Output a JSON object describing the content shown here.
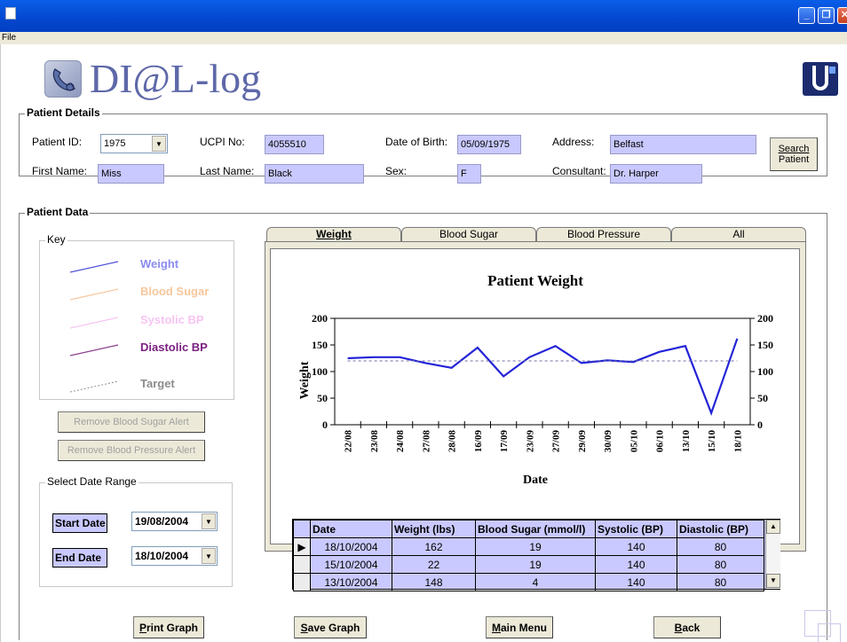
{
  "app": {
    "title": "DI@L-log",
    "menu_file": "File"
  },
  "patient_details": {
    "group_title": "Patient Details",
    "patient_id_label": "Patient ID:",
    "patient_id": "1975",
    "ucpi_label": "UCPI No:",
    "ucpi": "4055510",
    "dob_label": "Date of Birth:",
    "dob": "05/09/1975",
    "address_label": "Address:",
    "address": "Belfast",
    "first_name_label": "First Name:",
    "first_name": "Miss",
    "last_name_label": "Last Name:",
    "last_name": "Black",
    "sex_label": "Sex:",
    "sex": "F",
    "consultant_label": "Consultant:",
    "consultant": "Dr. Harper",
    "search_button": [
      "Search",
      "Patient"
    ]
  },
  "patient_data": {
    "group_title": "Patient Data",
    "key": {
      "title": "Key",
      "items": [
        {
          "label": "Weight",
          "color": "#8b8bf0",
          "line": "#5050d8"
        },
        {
          "label": "Blood Sugar",
          "color": "#f6c79c",
          "line": "#f6c79c"
        },
        {
          "label": "Systolic BP",
          "color": "#f7c4f2",
          "line": "#f7c4f2"
        },
        {
          "label": "Diastolic BP",
          "color": "#7a2080",
          "line": "#8a3c90"
        },
        {
          "label": "Target",
          "color": "#8c8c8c",
          "line": "#8c8c8c"
        }
      ]
    },
    "remove_sugar_alert": "Remove Blood Sugar Alert",
    "remove_bp_alert": "Remove Blood Pressure Alert",
    "date_range": {
      "title": "Select Date Range",
      "start_label": "Start Date",
      "start_value": "19/08/2004",
      "end_label": "End Date",
      "end_value": "18/10/2004"
    },
    "tabs": [
      "Weight",
      "Blood Sugar",
      "Blood Pressure",
      "All"
    ],
    "active_tab": "Weight"
  },
  "chart_data": {
    "type": "line",
    "title": "Patient Weight",
    "xlabel": "Date",
    "ylabel": "Weight",
    "categories": [
      "22/08",
      "23/08",
      "24/08",
      "27/08",
      "28/08",
      "16/09",
      "17/09",
      "23/09",
      "27/09",
      "29/09",
      "30/09",
      "05/10",
      "06/10",
      "13/10",
      "15/10",
      "18/10"
    ],
    "series": [
      {
        "name": "Weight",
        "values": [
          125,
          127,
          127,
          116,
          107,
          145,
          91,
          127,
          148,
          116,
          121,
          118,
          137,
          148,
          22,
          162
        ],
        "color": "#2424d8"
      },
      {
        "name": "Target",
        "values": [
          120,
          120,
          120,
          120,
          120,
          120,
          120,
          120,
          120,
          120,
          120,
          120,
          120,
          120,
          120,
          120
        ],
        "color": "#6f6faa",
        "dashed": true
      }
    ],
    "ylim": [
      0,
      200
    ],
    "yticks": [
      0,
      50,
      100,
      150,
      200
    ],
    "grid": false
  },
  "table": {
    "columns": [
      "Date",
      "Weight  (lbs)",
      "Blood Sugar (mmol/l)",
      "Systolic (BP)",
      "Diastolic (BP)"
    ],
    "rows": [
      [
        "18/10/2004",
        "162",
        "19",
        "140",
        "80"
      ],
      [
        "15/10/2004",
        "22",
        "19",
        "140",
        "80"
      ],
      [
        "13/10/2004",
        "148",
        "4",
        "140",
        "80"
      ]
    ]
  },
  "bottom_buttons": {
    "print": [
      "P",
      "rint Graph"
    ],
    "save": [
      "S",
      "ave Graph"
    ],
    "main": [
      "M",
      "ain Menu"
    ],
    "back": [
      "B",
      "ack"
    ]
  },
  "icons": {
    "phone": "phone-icon",
    "logo": "institution-logo"
  }
}
